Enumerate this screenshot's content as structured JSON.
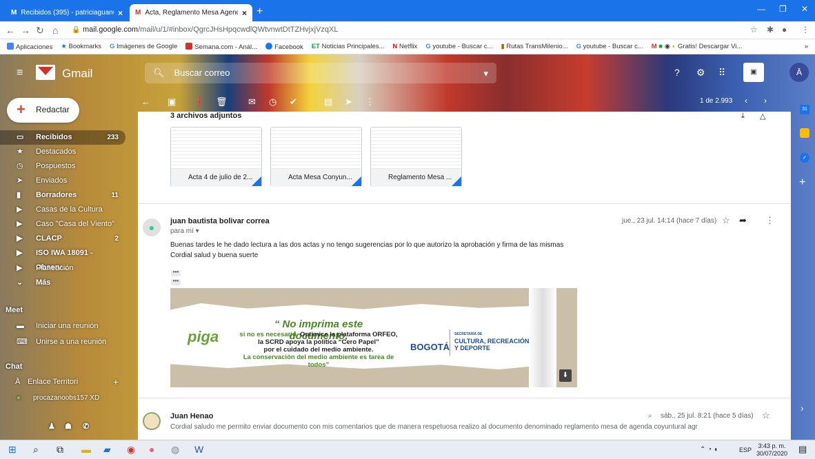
{
  "browser": {
    "tabs": [
      {
        "title": "Recibidos (395) - patriciaguanum",
        "close": "×"
      },
      {
        "title": "Acta, Reglamento Mesa Agenda",
        "close": "×"
      }
    ],
    "new_tab": "+",
    "url_host": "mail.google.com",
    "url_path": "/mail/u/1/#inbox/QgrcJHsHpqcwdlQWtvnwtDtTZHvjxjVzqXL",
    "bookmarks": [
      "Aplicaciones",
      "Bookmarks",
      "Imágenes de Google",
      "Semana.com - Anál...",
      "Facebook",
      "Noticias Principales...",
      "Netflix",
      "youtube - Buscar c...",
      "Rutas TransMilenio...",
      "youtube - Buscar c...",
      "Gratis! Descargar Vi..."
    ],
    "bookmarks_more": "»"
  },
  "gmail": {
    "brand": "Gmail",
    "search_placeholder": "Buscar correo",
    "compose": "Redactar",
    "pager": "1 de 2.993",
    "nav": [
      {
        "label": "Recibidos",
        "count": "233"
      },
      {
        "label": "Destacados",
        "count": ""
      },
      {
        "label": "Pospuestos",
        "count": ""
      },
      {
        "label": "Enviados",
        "count": ""
      },
      {
        "label": "Borradores",
        "count": "11"
      },
      {
        "label": "Casas de la Cultura",
        "count": ""
      },
      {
        "label": "Caso \"Casa del Viento\"",
        "count": ""
      },
      {
        "label": "CLACP",
        "count": "2"
      },
      {
        "label": "ISO IWA 18091 - Observ...",
        "count": ""
      },
      {
        "label": "Planeación",
        "count": ""
      },
      {
        "label": "Más",
        "count": ""
      }
    ],
    "meet": {
      "title": "Meet",
      "items": [
        "Iniciar una reunión",
        "Unirse a una reunión"
      ]
    },
    "chat": {
      "title": "Chat",
      "items": [
        "Enlace Territori",
        "procazanoobs157 XD"
      ]
    }
  },
  "thread": {
    "attachments_title": "3 archivos adjuntos",
    "attachments": [
      "Acta 4 de julio de 2...",
      "Acta Mesa Conyun...",
      "Reglamento Mesa ..."
    ],
    "msg1": {
      "sender": "juan bautista bolivar correa",
      "to": "para mí",
      "date": "jue., 23 jul. 14:14 (hace 7 días)",
      "line1": "Buenas tardes le he dado lectura a las dos actas y no tengo sugerencias por lo que autorizo la aprobación y firma de las mismas",
      "line2": "Cordial salud y buena suerte",
      "dots": "•••"
    },
    "banner": {
      "piga": "piga",
      "headline": "“ No imprima este documento,",
      "sub1": "si no es necesario.",
      "sub1b": " Optimice la plataforma ORFEO,",
      "sub2": "la SCRD apoya la política “Cero Papel”",
      "sub3": "por el cuidado del medio ambiente.",
      "sub4": "La conservación del medio ambiente es tarea de todos”",
      "bogota": "BOGOTÁ",
      "sec": "SECRETARÍA DE",
      "cult1": "CULTURA, RECREACIÓN",
      "cult2": "Y DEPORTE"
    },
    "msg2": {
      "sender": "Juan Henao",
      "date": "sáb., 25 jul. 8:21 (hace 5 días)",
      "preview": "Cordial saludo me permito enviar documento con mis comentarios que de manera respetuosa realizo al documento denominado reglamento mesa de agenda coyuntural agr"
    }
  },
  "taskbar": {
    "lang": "ESP",
    "time": "3:43 p. m.",
    "date": "30/07/2020"
  }
}
